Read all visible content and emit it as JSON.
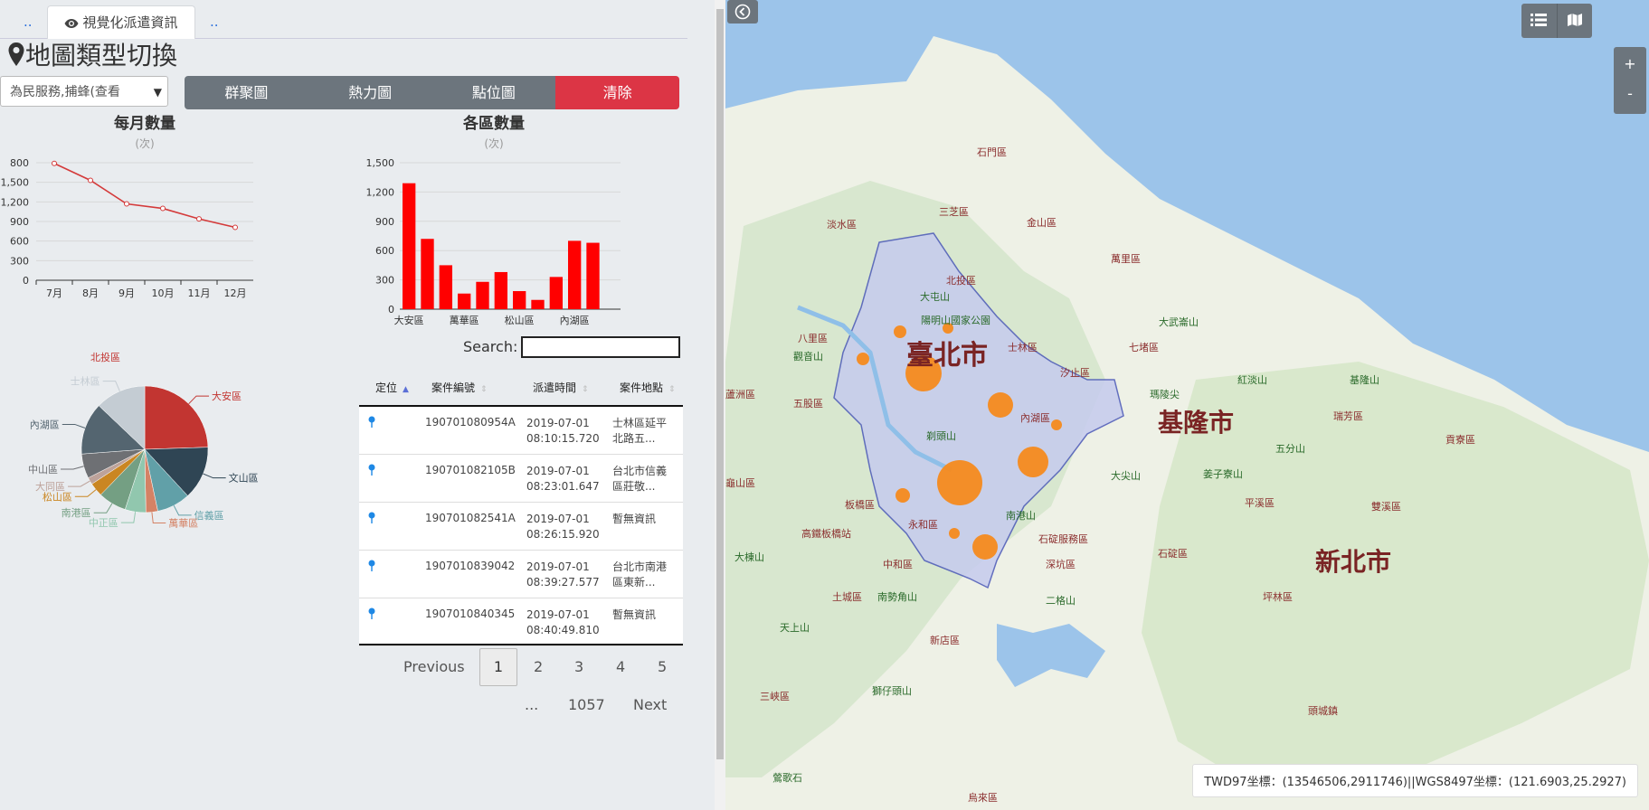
{
  "tabs": {
    "left": "..",
    "active": "視覺化派遣資訊",
    "right": ".."
  },
  "page_title": "地圖類型切換",
  "select": {
    "value": "為民服務,捕蜂(查看"
  },
  "buttons": {
    "cluster": "群聚圖",
    "heat": "熱力圖",
    "point": "點位圖",
    "clear": "清除"
  },
  "monthly_chart": {
    "title": "每月數量",
    "subtitle": "(次)"
  },
  "district_chart": {
    "title": "各區數量",
    "subtitle": "(次)"
  },
  "chart_data": [
    {
      "type": "line",
      "title": "每月數量",
      "ylabel": "(次)",
      "categories": [
        "7月",
        "8月",
        "9月",
        "10月",
        "11月",
        "12月"
      ],
      "values": [
        1790,
        1530,
        1170,
        1100,
        940,
        810
      ],
      "y_ticks": [
        "0",
        "300",
        "600",
        "900",
        "1,200",
        "1,500",
        "800"
      ],
      "color": "#d43a3a"
    },
    {
      "type": "bar",
      "title": "各區數量",
      "ylabel": "(次)",
      "categories": [
        "大安區",
        "文山區",
        "信義區",
        "萬華區",
        "中正區",
        "南港區",
        "松山區",
        "大同區",
        "中山區",
        "內湖區",
        "士林區",
        "北投區"
      ],
      "x_tick_labels": [
        "大安區",
        "萬華區",
        "松山區",
        "內湖區"
      ],
      "values": [
        1290,
        720,
        450,
        160,
        280,
        380,
        185,
        95,
        330,
        700,
        680,
        0
      ],
      "y_ticks": [
        "0",
        "300",
        "600",
        "900",
        "1,200",
        "1,500"
      ],
      "ylim": [
        0,
        1500
      ],
      "color": "#ff0000"
    },
    {
      "type": "pie",
      "labels": [
        "大安區",
        "文山區",
        "信義區",
        "萬華區",
        "中正區",
        "南港區",
        "松山區",
        "大同區",
        "中山區",
        "內湖區",
        "士林區",
        "北投區"
      ],
      "values": [
        1290,
        720,
        450,
        160,
        280,
        380,
        185,
        95,
        330,
        700,
        680,
        0
      ],
      "colors": [
        "#c23531",
        "#2f4554",
        "#61a0a8",
        "#d48265",
        "#91c7ae",
        "#749f83",
        "#ca8622",
        "#bda29a",
        "#6e7074",
        "#546570",
        "#c4ccd3",
        "#c23531"
      ]
    }
  ],
  "search": {
    "label": "Search:",
    "value": ""
  },
  "table": {
    "headers": [
      "定位",
      "案件編號",
      "派遣時間",
      "案件地點"
    ],
    "rows": [
      {
        "case": "190701080954A",
        "date": "2019-07-01",
        "time": "08:10:15.720",
        "loc1": "士林區延平",
        "loc2": "北路五..."
      },
      {
        "case": "190701082105B",
        "date": "2019-07-01",
        "time": "08:23:01.647",
        "loc1": "台北市信義",
        "loc2": "區莊敬..."
      },
      {
        "case": "190701082541A",
        "date": "2019-07-01",
        "time": "08:26:15.920",
        "loc1": "暫無資訊",
        "loc2": ""
      },
      {
        "case": "1907010839042",
        "date": "2019-07-01",
        "time": "08:39:27.577",
        "loc1": "台北市南港",
        "loc2": "區東新..."
      },
      {
        "case": "1907010840345",
        "date": "2019-07-01",
        "time": "08:40:49.810",
        "loc1": "暫無資訊",
        "loc2": ""
      }
    ]
  },
  "pagination": {
    "previous": "Previous",
    "pages": [
      "1",
      "2",
      "3",
      "4",
      "5"
    ],
    "ellipsis": "...",
    "last": "1057",
    "next": "Next"
  },
  "map": {
    "zoom_in": "+",
    "zoom_out": "-",
    "coord": "TWD97坐標：(13546506,2911746)||WGS8497坐標：(121.6903,25.2927)",
    "cities": {
      "taipei": "臺北市",
      "keelung": "基隆市",
      "newtaipei": "新北市"
    },
    "places": [
      "石門區",
      "三芝區",
      "金山區",
      "淡水區",
      "萬里區",
      "北投區",
      "大屯山",
      "陽明山國家公園",
      "士林區",
      "八里區",
      "觀音山",
      "汐止區",
      "七堵區",
      "大武崙山",
      "五股區",
      "內湖區",
      "瑪陵尖",
      "紅淡山",
      "基隆山",
      "瑞芳區",
      "貢寮區",
      "蘆洲區",
      "剃頭山",
      "五分山",
      "板橋區",
      "高鐵板橋站",
      "南港山",
      "石碇區",
      "平溪區",
      "雙溪區",
      "中和區",
      "永和區",
      "深坑區",
      "新店區",
      "土城區",
      "南勢角山",
      "二格山",
      "坪林區",
      "三峽區",
      "獅仔頭山",
      "頭城鎮",
      "烏來區",
      "大棟山",
      "天上山",
      "姜子寮山",
      "大尖山",
      "石碇服務區",
      "龜山區",
      "鶯歌石"
    ]
  }
}
